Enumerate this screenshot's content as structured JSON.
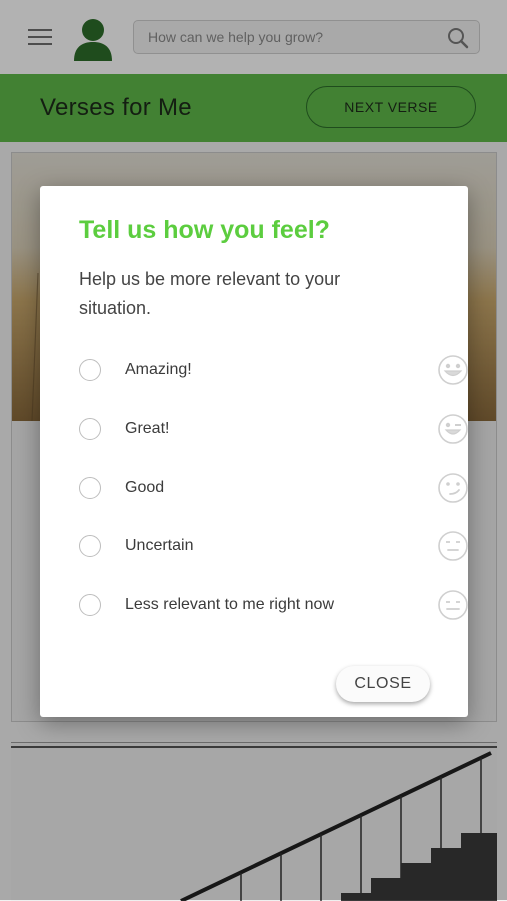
{
  "header": {
    "menu_icon": "hamburger-menu-icon",
    "avatar_icon": "user-avatar-icon",
    "search": {
      "placeholder": "How can we help you grow?",
      "icon": "search-icon"
    }
  },
  "title_bar": {
    "title": "Verses for Me",
    "next_button": "NEXT VERSE"
  },
  "colors": {
    "brand_green": "#5fb94a",
    "title_green": "#5ccd3f"
  },
  "dialog": {
    "title": "Tell us how you feel?",
    "description": "Help us be more relevant to your situation.",
    "options": [
      {
        "label": "Amazing!",
        "icon": "grinning-face-icon"
      },
      {
        "label": "Great!",
        "icon": "winking-face-icon"
      },
      {
        "label": "Good",
        "icon": "smirking-face-icon"
      },
      {
        "label": "Uncertain",
        "icon": "neutral-face-icon"
      },
      {
        "label": "Less relevant to me right now",
        "icon": "expressionless-face-icon"
      }
    ],
    "close_button": "CLOSE"
  }
}
